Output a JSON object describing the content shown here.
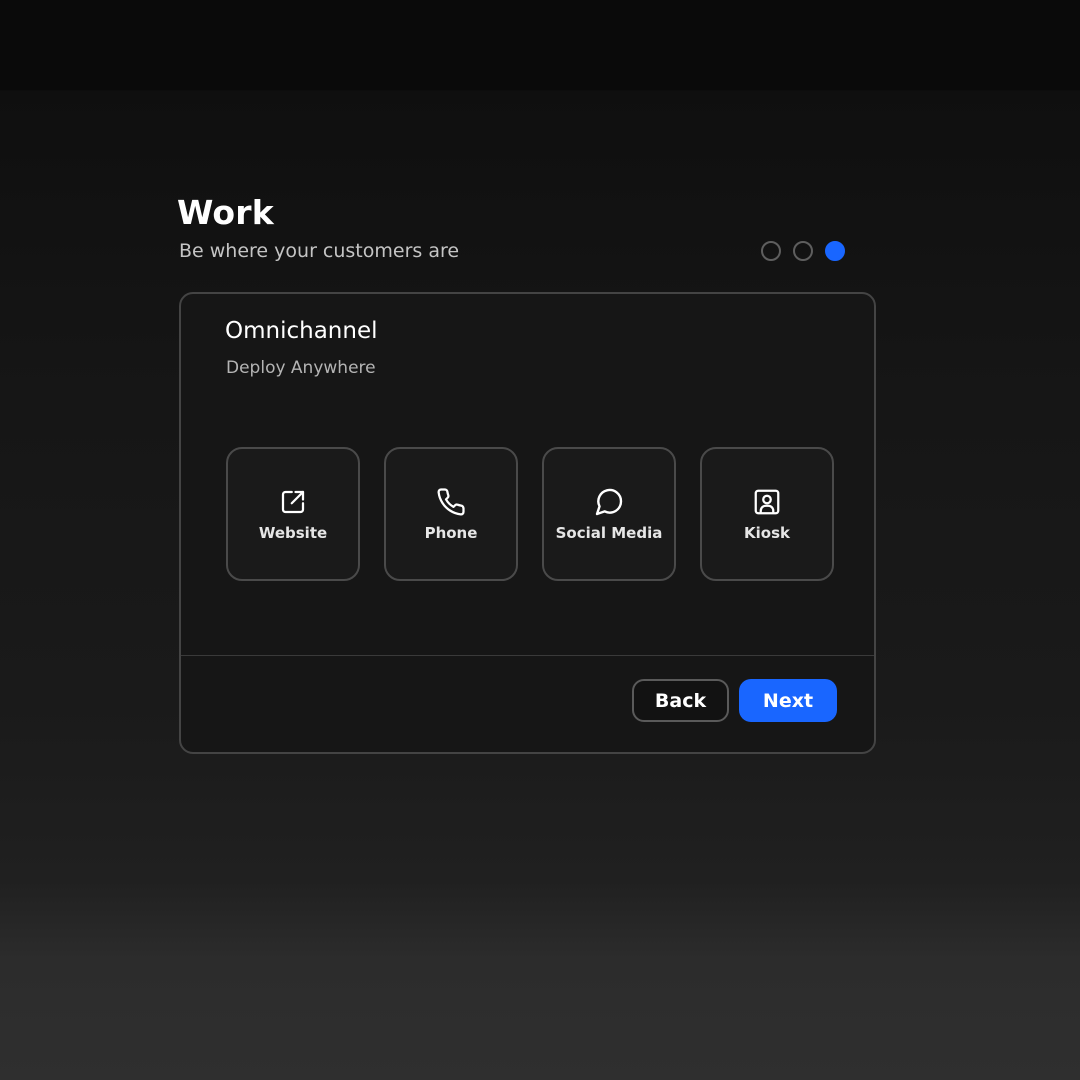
{
  "header": {
    "title": "Work",
    "subtitle": "Be where your customers are"
  },
  "stepper": {
    "total": 3,
    "current": 3,
    "active_color": "#1966ff"
  },
  "card": {
    "title": "Omnichannel",
    "subtitle": "Deploy Anywhere",
    "channels": [
      {
        "label": "Website",
        "icon": "external-link-icon"
      },
      {
        "label": "Phone",
        "icon": "phone-icon"
      },
      {
        "label": "Social Media",
        "icon": "chat-bubble-icon"
      },
      {
        "label": "Kiosk",
        "icon": "kiosk-user-icon"
      }
    ]
  },
  "actions": {
    "back_label": "Back",
    "next_label": "Next"
  },
  "colors": {
    "accent": "#1966ff",
    "background": "#111111",
    "card_border": "#444444"
  }
}
